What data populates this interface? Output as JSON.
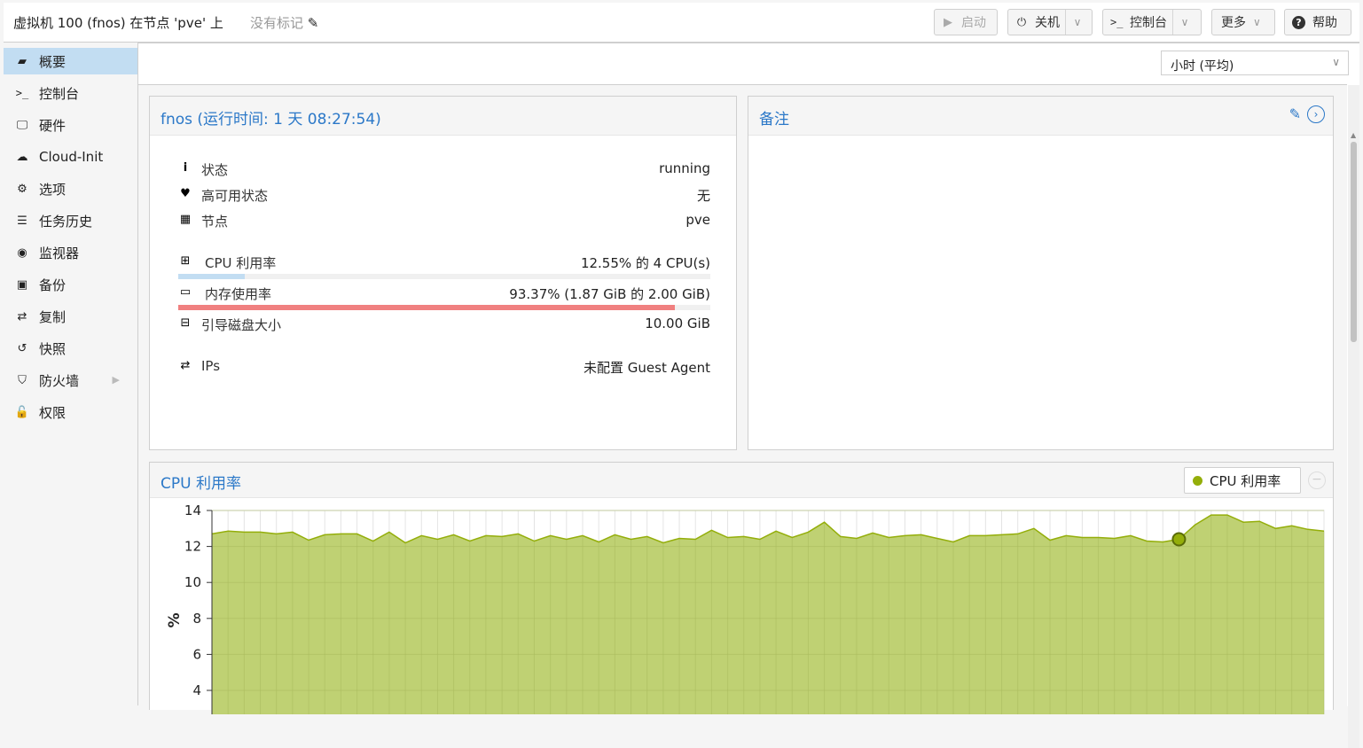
{
  "header": {
    "title": "虚拟机 100 (fnos) 在节点 'pve' 上",
    "tags": "没有标记",
    "start_label": "启动",
    "shutdown_label": "关机",
    "console_label": "控制台",
    "more_label": "更多",
    "help_label": "帮助"
  },
  "sidebar": {
    "items": [
      {
        "label": "概要",
        "icon": "book-icon"
      },
      {
        "label": "控制台",
        "icon": "terminal-icon"
      },
      {
        "label": "硬件",
        "icon": "desktop-icon"
      },
      {
        "label": "Cloud-Init",
        "icon": "cloud-icon"
      },
      {
        "label": "选项",
        "icon": "gear-icon"
      },
      {
        "label": "任务历史",
        "icon": "list-icon"
      },
      {
        "label": "监视器",
        "icon": "eye-icon"
      },
      {
        "label": "备份",
        "icon": "floppy-icon"
      },
      {
        "label": "复制",
        "icon": "retweet-icon"
      },
      {
        "label": "快照",
        "icon": "history-icon"
      },
      {
        "label": "防火墙",
        "icon": "shield-icon"
      },
      {
        "label": "权限",
        "icon": "unlock-icon"
      }
    ]
  },
  "timeframe": "小时 (平均)",
  "status_panel": {
    "title": "fnos (运行时间: 1 天 08:27:54)",
    "status_label": "状态",
    "status_value": "running",
    "ha_label": "高可用状态",
    "ha_value": "无",
    "node_label": "节点",
    "node_value": "pve",
    "cpu_label": "CPU 利用率",
    "cpu_value": "12.55% 的 4 CPU(s)",
    "cpu_fraction": 0.1255,
    "mem_label": "内存使用率",
    "mem_value": "93.37% (1.87 GiB 的 2.00 GiB)",
    "mem_fraction": 0.9337,
    "disk_label": "引导磁盘大小",
    "disk_value": "10.00 GiB",
    "ips_label": "IPs",
    "ips_value": "未配置 Guest Agent"
  },
  "notes_panel": {
    "title": "备注"
  },
  "cpu_panel": {
    "title": "CPU 利用率",
    "legend": "CPU 利用率"
  },
  "colors": {
    "accent": "#2b78c8",
    "cpu_fill": "#bccf6b",
    "cpu_line": "#94ae0a",
    "mem_bar": "#f08080",
    "cpu_bar": "#c2ddf2"
  },
  "chart_data": {
    "type": "area",
    "ylabel": "%",
    "yticks": [
      4,
      6,
      8,
      10,
      12,
      14
    ],
    "ylim": [
      3,
      14
    ],
    "series": [
      {
        "name": "CPU 利用率",
        "values": [
          12.7,
          12.85,
          12.8,
          12.8,
          12.7,
          12.8,
          12.35,
          12.65,
          12.7,
          12.7,
          12.3,
          12.8,
          12.2,
          12.6,
          12.4,
          12.65,
          12.3,
          12.6,
          12.55,
          12.7,
          12.3,
          12.6,
          12.4,
          12.6,
          12.25,
          12.65,
          12.4,
          12.55,
          12.2,
          12.45,
          12.4,
          12.9,
          12.5,
          12.55,
          12.4,
          12.85,
          12.5,
          12.8,
          13.35,
          12.55,
          12.45,
          12.75,
          12.5,
          12.6,
          12.65,
          12.45,
          12.25,
          12.6,
          12.6,
          12.65,
          12.7,
          13.0,
          12.35,
          12.6,
          12.5,
          12.5,
          12.45,
          12.6,
          12.3,
          12.25,
          12.4,
          13.2,
          13.75,
          13.75,
          13.35,
          13.4,
          13.0,
          13.15,
          12.95,
          12.85
        ]
      }
    ],
    "highlight_index": 60
  }
}
